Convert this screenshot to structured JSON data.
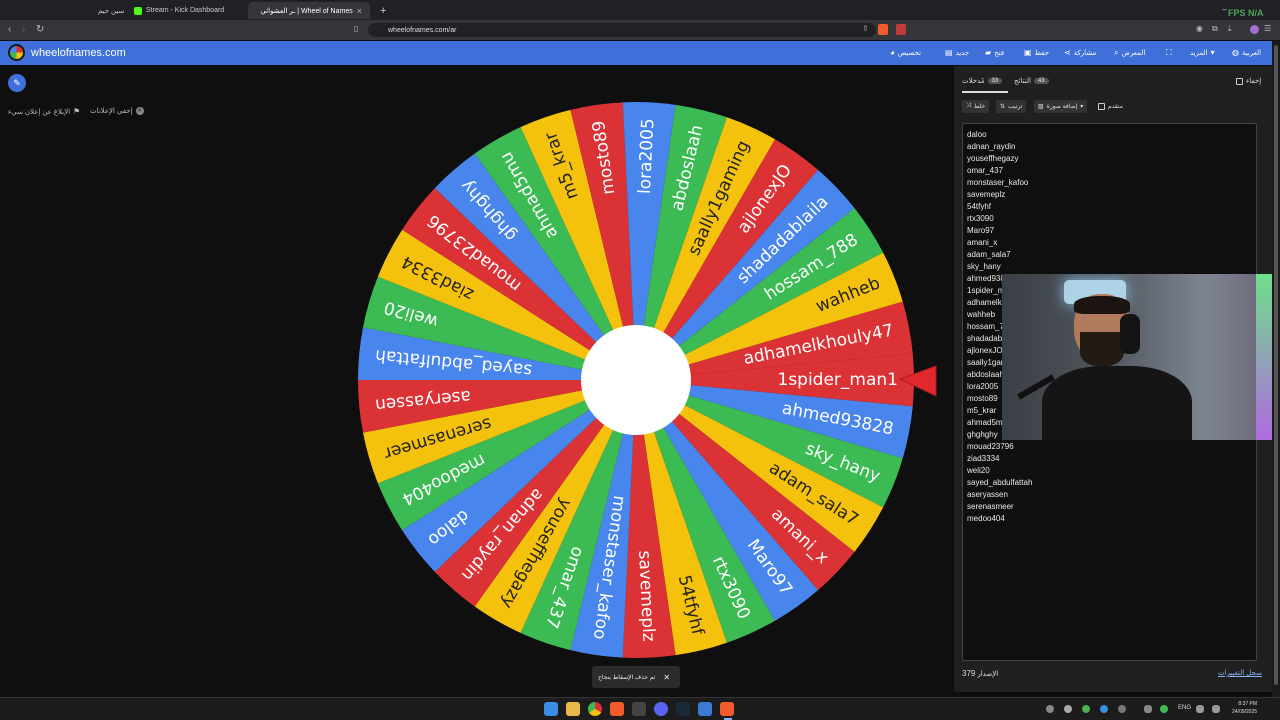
{
  "browser": {
    "tabs": [
      {
        "label": "سين جيم",
        "active": false
      },
      {
        "label": "Stream - Kick Dashboard",
        "active": false
      },
      {
        "label": "ـر العشوائي | Wheel of Names",
        "active": true
      }
    ],
    "new_tab": "+",
    "url": "wheelofnames.com/ar",
    "fps_overlay": "FPS N/A"
  },
  "header": {
    "site_name": "wheelofnames.com",
    "menu": [
      {
        "label": "تخصيص",
        "icon": "palette-icon"
      },
      {
        "label": "جديد",
        "icon": "new-file-icon"
      },
      {
        "label": "فتح",
        "icon": "folder-icon"
      },
      {
        "label": "حفظ",
        "icon": "save-icon"
      },
      {
        "label": "مشاركة",
        "icon": "share-icon"
      },
      {
        "label": "المعرض",
        "icon": "search-icon"
      },
      {
        "label": "",
        "icon": "fullscreen-icon"
      },
      {
        "label": "المزيد",
        "icon": "chevron-down-icon"
      },
      {
        "label": "العربية",
        "icon": "globe-icon"
      }
    ]
  },
  "ads": {
    "hide_ads": "إخفي الإعلانات",
    "report_ad": "الإبلاغ عن إعلان سيء"
  },
  "wheel": {
    "entries": [
      "1spider_man1",
      "ahmed93828",
      "sky_hany",
      "adam_sala7",
      "amani_x",
      "Maro97",
      "rtx3090",
      "54tfyhf",
      "savemeplz",
      "monstaser_kafoo",
      "omar_437",
      "youseffhegazy",
      "adnan_raydin",
      "daloo",
      "medoo404",
      "serenasmeer",
      "aseryassen",
      "sayed_abdulfattah",
      "weli20",
      "ziad3334",
      "mouad23796",
      "ghghghy",
      "ahmad5mu",
      "m5_krar",
      "mosto89",
      "lora2005",
      "abdoslaah",
      "saally1gaming",
      "ajlonexJO",
      "shadadablaila",
      "hossam_788",
      "wahheb",
      "adhamelkhouly47"
    ],
    "colors": [
      "#db3236",
      "#4885ed",
      "#3cba54",
      "#f4c20d"
    ]
  },
  "toast": {
    "message": "تم حذف الإسقاط بنجاح",
    "close": "✕"
  },
  "panel": {
    "tabs": [
      {
        "label": "مُدخلات",
        "count": "33"
      },
      {
        "label": "النتائج",
        "count": "43"
      }
    ],
    "hide_label": "إخفاء",
    "tools": {
      "shuffle": "خلط",
      "sort": "ترتيب",
      "add_image": "إضافة صورة",
      "advanced": "متقدم"
    },
    "entries": [
      "daloo",
      "adnan_raydin",
      "youseffhegazy",
      "omar_437",
      "monstaser_kafoo",
      "savemeplz",
      "54tfyhf",
      "rtx3090",
      "Maro97",
      "amani_x",
      "adam_sala7",
      "sky_hany",
      "ahmed93828",
      "1spider_man1",
      "adhamelkhouly47",
      "wahheb",
      "hossam_788",
      "shadadablaila",
      "ajlonexJO",
      "saally1gaming",
      "abdoslaah",
      "lora2005",
      "mosto89",
      "m5_krar",
      "ahmad5mu",
      "ghghghy",
      "mouad23796",
      "ziad3334",
      "weli20",
      "sayed_abdulfattah",
      "aseryassen",
      "serenasmeer",
      "medoo404"
    ],
    "version_label": "الإصدار",
    "version_number": "379",
    "changelog": "سجل التغييرات"
  },
  "taskbar": {
    "lang": "ENG",
    "time": "8:37 PM",
    "date": "24/09/2025"
  }
}
